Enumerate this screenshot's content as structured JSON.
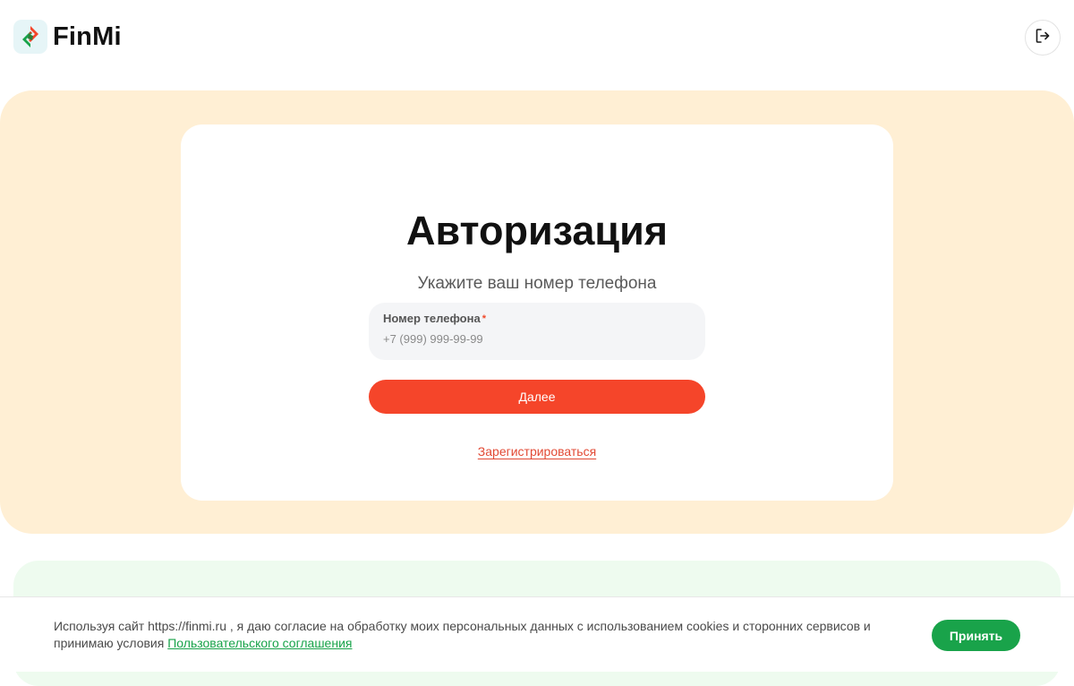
{
  "header": {
    "brand_name": "FinMi",
    "logo_icon": "finmi-logo-icon",
    "logout_icon": "logout-icon"
  },
  "auth": {
    "title": "Авторизация",
    "subtitle": "Укажите ваш номер телефона",
    "phone_label": "Номер телефона",
    "required_mark": "*",
    "phone_value": "",
    "phone_placeholder": "+7 (999) 999-99-99",
    "submit_label": "Далее",
    "register_label": "Зарегистрироваться"
  },
  "cookie_banner": {
    "text": "Используя сайт https://finmi.ru , я даю согласие на обработку моих персональных данных с использованием cookies и сторонних сервисов и принимаю условия",
    "link_text": "Пользовательского соглашения",
    "accept_label": "Принять"
  },
  "colors": {
    "brand_orange": "#f5452a",
    "brand_green": "#19a34a",
    "hero_background": "#ffefd4",
    "link_red": "#e24a35"
  }
}
